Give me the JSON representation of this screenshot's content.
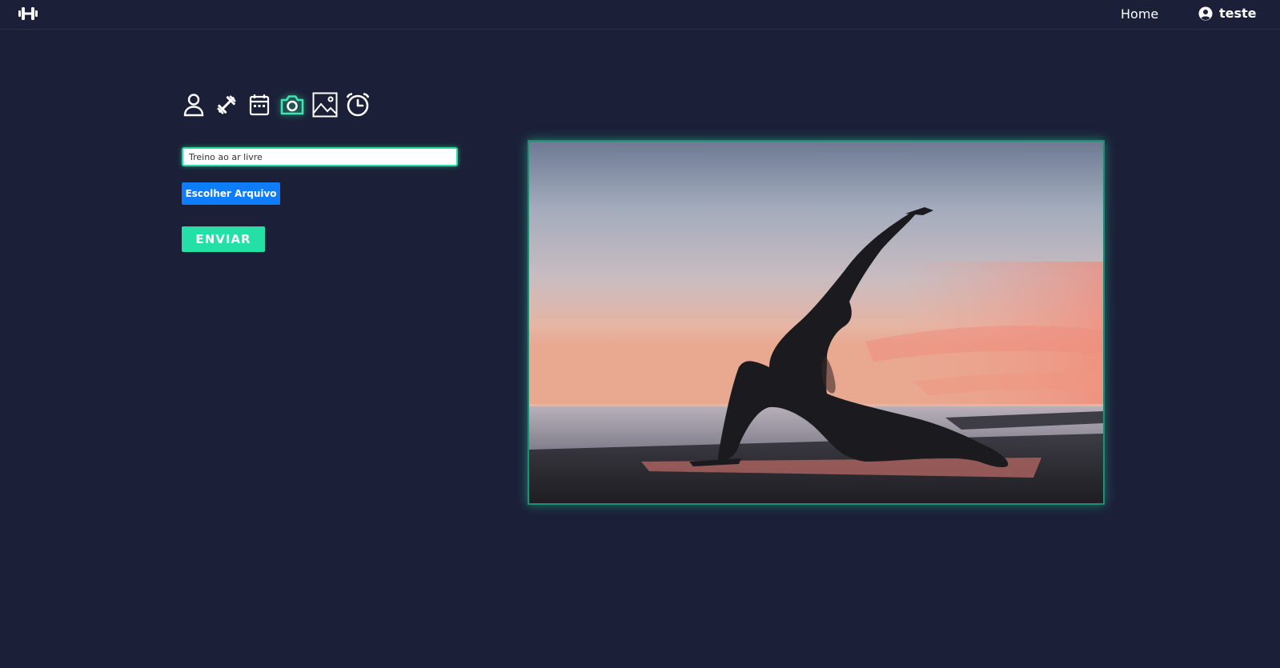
{
  "nav": {
    "logo_icon": "dumbbell-icon",
    "home_label": "Home",
    "user_icon": "user-circle-icon",
    "username": "teste"
  },
  "steps": [
    {
      "icon": "user-icon",
      "active": false
    },
    {
      "icon": "dumbbell-icon",
      "active": false
    },
    {
      "icon": "calendar-icon",
      "active": false
    },
    {
      "icon": "camera-icon",
      "active": true
    },
    {
      "icon": "image-icon",
      "active": false
    },
    {
      "icon": "alarm-clock-icon",
      "active": false
    }
  ],
  "form": {
    "caption_value": "Treino ao ar livre",
    "file_button_label": "Escolher Arquivo",
    "submit_label": "ENVIAR"
  },
  "colors": {
    "background": "#1b2038",
    "accent": "#23e0a7",
    "file_button": "#0d7dfc"
  }
}
